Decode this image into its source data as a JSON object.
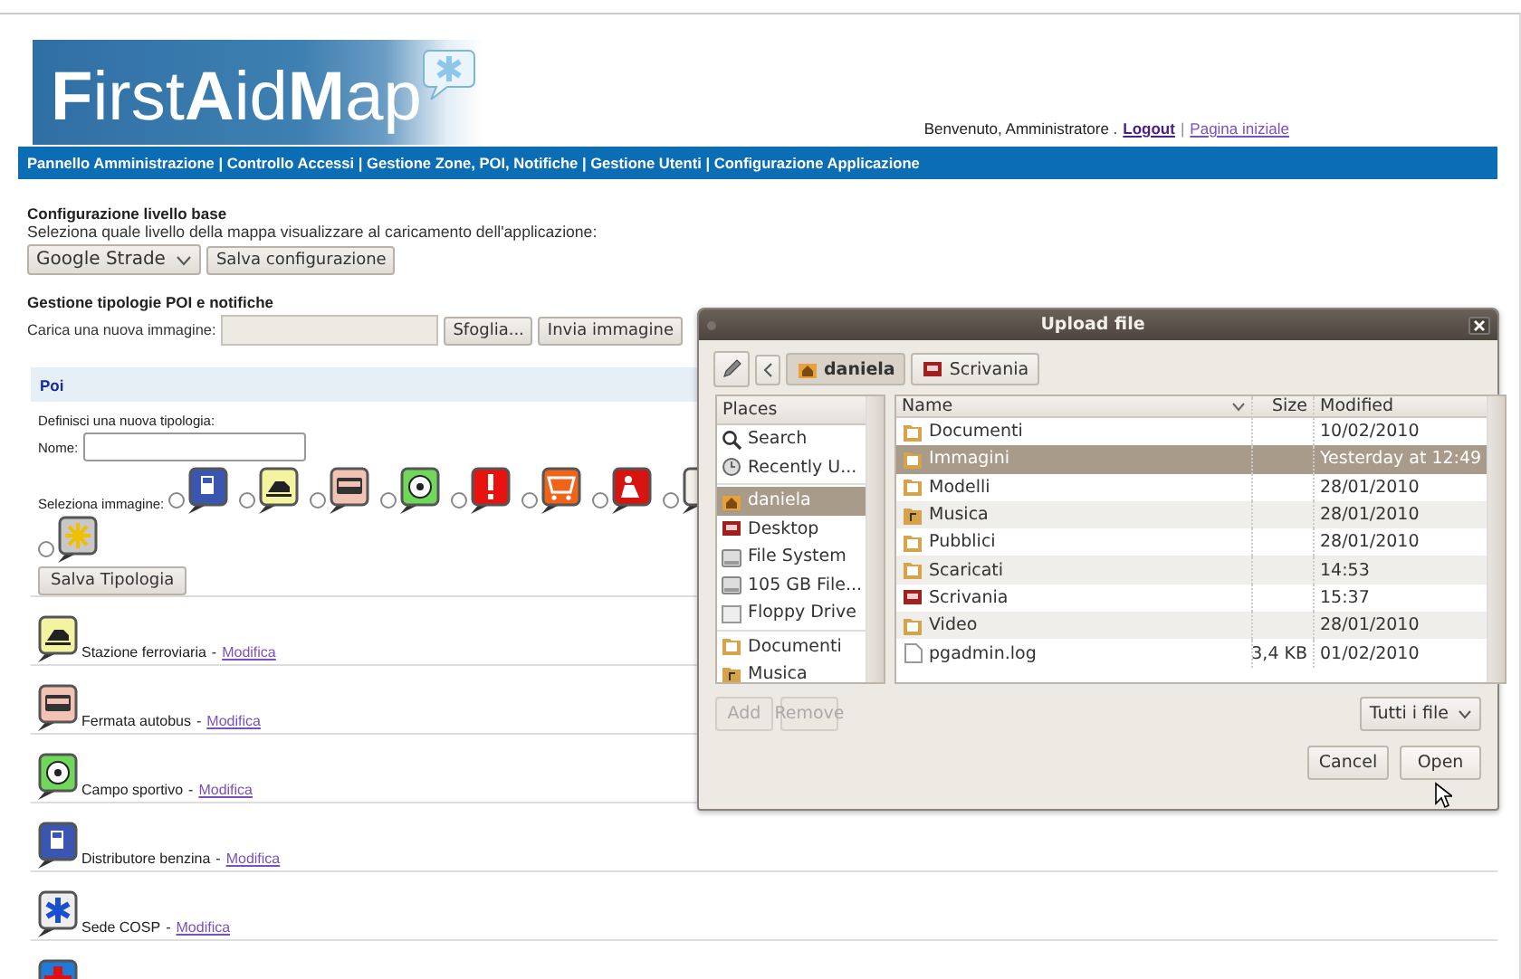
{
  "logo": {
    "text": "**F**irst**A**id**M**ap"
  },
  "user_bar": {
    "greeting": "Benvenuto, Amministratore .",
    "links": [
      {
        "label": "Logout"
      },
      {
        "label": "Pagina iniziale"
      }
    ],
    "separator": "|"
  },
  "nav": "Pannello Amministrazione | Controllo Accessi | Gestione Zone, POI, Notifiche | Gestione Utenti | Configurazione Applicazione",
  "base_layer": {
    "title": "Configurazione livello base",
    "description": "Seleziona quale livello della mappa visualizzare al caricamento dell'applicazione:",
    "select": "Google Strade",
    "button": "Salva configurazione"
  },
  "poi_types": {
    "title": "Gestione tipologie POI e notifiche",
    "upload_label": "Carica una nuova immagine:",
    "browse_button": "Sfoglia...",
    "send_button": "Invia immagine"
  },
  "poi_panel": {
    "header": "Poi",
    "new_type_label": "Definisci una nuova tipologia:",
    "name_label": "Nome:",
    "image_label": "Seleziona immagine:",
    "images": [
      {
        "color": "#3a56b0",
        "kind": "pump",
        "selected": false
      },
      {
        "color": "#f4f3a0",
        "kind": "train",
        "selected": false
      },
      {
        "color": "#f2c2b4",
        "kind": "bus",
        "selected": false
      },
      {
        "color": "#6fd85a",
        "kind": "ball",
        "selected": false
      },
      {
        "color": "#e8120e",
        "kind": "alert",
        "selected": false
      },
      {
        "color": "#f0631a",
        "kind": "cart",
        "selected": false
      },
      {
        "color": "#d81410",
        "kind": "worker",
        "selected": false
      },
      {
        "color": "#f2f0e8",
        "kind": "plain",
        "selected": false
      },
      {
        "color": "#c8c8c8",
        "kind": "flake",
        "selected": false
      }
    ],
    "save_button": "Salva Tipologia"
  },
  "poi_list": {
    "separator": "-",
    "items": [
      {
        "label": "Stazione ferroviaria",
        "link": "Modifica",
        "color": "#f4f3a0",
        "kind": "train"
      },
      {
        "label": "Fermata autobus",
        "link": "Modifica",
        "color": "#f2c2b4",
        "kind": "bus"
      },
      {
        "label": "Campo sportivo",
        "link": "Modifica",
        "color": "#6fd85a",
        "kind": "ball"
      },
      {
        "label": "Distributore benzina",
        "link": "Modifica",
        "color": "#3a56b0",
        "kind": "pump"
      },
      {
        "label": "Sede COSP",
        "link": "Modifica",
        "color": "#eeeeee",
        "kind": "star"
      },
      {
        "color": "#1f7ad8",
        "kind": "cross"
      }
    ]
  },
  "dialog": {
    "title": "Upload file",
    "path": [
      {
        "label": "daniela",
        "selected": true,
        "kind": "home"
      },
      {
        "label": "Scrivania",
        "selected": false,
        "kind": "desktop"
      }
    ],
    "places_header": "Places",
    "places": [
      [
        {
          "label": "Search",
          "kind": "search",
          "selected": false
        },
        {
          "label": "Recently U...",
          "kind": "recent",
          "selected": false
        }
      ],
      [
        {
          "label": "daniela",
          "kind": "home",
          "selected": true
        },
        {
          "label": "Desktop",
          "kind": "desktop",
          "selected": false
        },
        {
          "label": "File System",
          "kind": "drive",
          "selected": false
        },
        {
          "label": "105 GB File...",
          "kind": "drive",
          "selected": false
        },
        {
          "label": "Floppy Drive",
          "kind": "floppy",
          "selected": false
        }
      ],
      [
        {
          "label": "Documenti",
          "kind": "folder",
          "selected": false
        },
        {
          "label": "Musica",
          "kind": "music",
          "selected": false
        }
      ]
    ],
    "columns": [
      "Name",
      "Size",
      "Modified"
    ],
    "files": [
      {
        "name": "Documenti",
        "modified": "10/02/2010",
        "kind": "folder",
        "selected": false
      },
      {
        "name": "Immagini",
        "modified": "Yesterday at 12:49",
        "kind": "folder",
        "selected": true
      },
      {
        "name": "Modelli",
        "modified": "28/01/2010",
        "kind": "folder",
        "selected": false
      },
      {
        "name": "Musica",
        "modified": "28/01/2010",
        "kind": "music",
        "selected": false
      },
      {
        "name": "Pubblici",
        "modified": "28/01/2010",
        "kind": "folder",
        "selected": false
      },
      {
        "name": "Scaricati",
        "modified": "14:53",
        "kind": "folder",
        "selected": false
      },
      {
        "name": "Scrivania",
        "modified": "15:37",
        "kind": "desktop",
        "selected": false
      },
      {
        "name": "Video",
        "modified": "28/01/2010",
        "kind": "folder",
        "selected": false
      },
      {
        "name": "pgadmin.log",
        "size": "3,4 KB",
        "modified": "01/02/2010",
        "kind": "file",
        "selected": false
      }
    ],
    "add_button": {
      "label": "Add",
      "disabled": true
    },
    "remove_button": {
      "label": "Remove",
      "disabled": true
    },
    "filter": "Tutti i file",
    "cancel_button": "Cancel",
    "open_button": "Open"
  }
}
